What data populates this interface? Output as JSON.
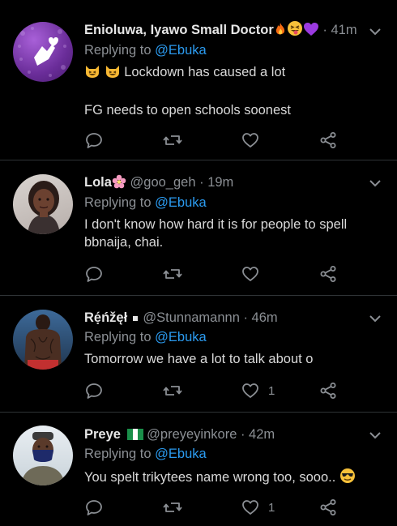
{
  "tweets": [
    {
      "name": "Enioluwa, Iyawo Small Doctor",
      "handle": "",
      "time": "· 41m",
      "replying_prefix": "Replying to",
      "replying_to": "@Ebuka",
      "text_line1": "Lockdown has caused a lot",
      "text_line2": "FG needs to open schools soonest",
      "like_count": ""
    },
    {
      "name": "Lola",
      "handle": "@goo_geh",
      "time": "· 19m",
      "replying_prefix": "Replying to",
      "replying_to": "@Ebuka",
      "text": "I don't know how hard it is for people to spell bbnaija, chai.",
      "like_count": ""
    },
    {
      "name": "Rẹ́ńžęł",
      "handle": "@Stunnamannn",
      "time": "· 46m",
      "replying_prefix": "Replying to",
      "replying_to": "@Ebuka",
      "text": "Tomorrow we have a lot to talk about o",
      "like_count": "1"
    },
    {
      "name": "Preye",
      "handle": "@preyeyinkore",
      "time": "· 42m",
      "replying_prefix": "Replying to",
      "replying_to": "@Ebuka",
      "text": "You spelt trikytees name wrong too, sooo..",
      "like_count": "1"
    }
  ],
  "icons": [
    "reply-icon",
    "retweet-icon",
    "like-icon",
    "share-icon",
    "chevron-down-icon"
  ],
  "colors": {
    "background": "#000000",
    "link": "#2b9bf0",
    "muted": "#8b8f94",
    "divider": "#2f3336"
  }
}
